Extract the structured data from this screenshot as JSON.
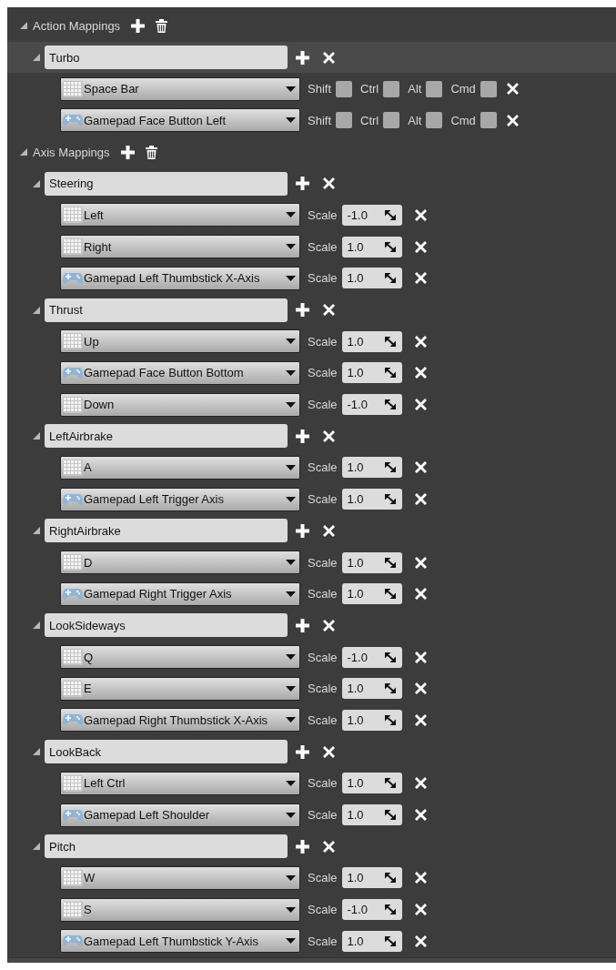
{
  "action_mappings": {
    "label": "Action Mappings",
    "mappings": [
      {
        "name": "Turbo",
        "hovered": true,
        "keys": [
          {
            "kind": "keyboard",
            "key": "Space Bar",
            "modifiers": [
              {
                "label": "Shift",
                "checked": false
              },
              {
                "label": "Ctrl",
                "checked": false
              },
              {
                "label": "Alt",
                "checked": false
              },
              {
                "label": "Cmd",
                "checked": false
              }
            ]
          },
          {
            "kind": "gamepad",
            "key": "Gamepad Face Button Left",
            "modifiers": [
              {
                "label": "Shift",
                "checked": false
              },
              {
                "label": "Ctrl",
                "checked": false
              },
              {
                "label": "Alt",
                "checked": false
              },
              {
                "label": "Cmd",
                "checked": false
              }
            ]
          }
        ]
      }
    ]
  },
  "axis_mappings": {
    "label": "Axis Mappings",
    "mappings": [
      {
        "name": "Steering",
        "hovered": false,
        "keys": [
          {
            "kind": "keyboard",
            "key": "Left",
            "scale_label": "Scale",
            "scale": "-1.0"
          },
          {
            "kind": "keyboard",
            "key": "Right",
            "scale_label": "Scale",
            "scale": "1.0"
          },
          {
            "kind": "gamepad",
            "key": "Gamepad Left Thumbstick X-Axis",
            "scale_label": "Scale",
            "scale": "1.0"
          }
        ]
      },
      {
        "name": "Thrust",
        "hovered": false,
        "keys": [
          {
            "kind": "keyboard",
            "key": "Up",
            "scale_label": "Scale",
            "scale": "1.0"
          },
          {
            "kind": "gamepad",
            "key": "Gamepad Face Button Bottom",
            "scale_label": "Scale",
            "scale": "1.0"
          },
          {
            "kind": "keyboard",
            "key": "Down",
            "scale_label": "Scale",
            "scale": "-1.0"
          }
        ]
      },
      {
        "name": "LeftAirbrake",
        "hovered": false,
        "keys": [
          {
            "kind": "keyboard",
            "key": "A",
            "scale_label": "Scale",
            "scale": "1.0"
          },
          {
            "kind": "gamepad",
            "key": "Gamepad Left Trigger Axis",
            "scale_label": "Scale",
            "scale": "1.0"
          }
        ]
      },
      {
        "name": "RightAirbrake",
        "hovered": false,
        "keys": [
          {
            "kind": "keyboard",
            "key": "D",
            "scale_label": "Scale",
            "scale": "1.0"
          },
          {
            "kind": "gamepad",
            "key": "Gamepad Right Trigger Axis",
            "scale_label": "Scale",
            "scale": "1.0"
          }
        ]
      },
      {
        "name": "LookSideways",
        "hovered": false,
        "keys": [
          {
            "kind": "keyboard",
            "key": "Q",
            "scale_label": "Scale",
            "scale": "-1.0"
          },
          {
            "kind": "keyboard",
            "key": "E",
            "scale_label": "Scale",
            "scale": "1.0"
          },
          {
            "kind": "gamepad",
            "key": "Gamepad Right Thumbstick X-Axis",
            "scale_label": "Scale",
            "scale": "1.0"
          }
        ]
      },
      {
        "name": "LookBack",
        "hovered": false,
        "keys": [
          {
            "kind": "keyboard",
            "key": "Left Ctrl",
            "scale_label": "Scale",
            "scale": "1.0"
          },
          {
            "kind": "gamepad",
            "key": "Gamepad Left Shoulder",
            "scale_label": "Scale",
            "scale": "1.0"
          }
        ]
      },
      {
        "name": "Pitch",
        "hovered": false,
        "keys": [
          {
            "kind": "keyboard",
            "key": "W",
            "scale_label": "Scale",
            "scale": "1.0"
          },
          {
            "kind": "keyboard",
            "key": "S",
            "scale_label": "Scale",
            "scale": "-1.0"
          },
          {
            "kind": "gamepad",
            "key": "Gamepad Left Thumbstick Y-Axis",
            "scale_label": "Scale",
            "scale": "1.0"
          }
        ]
      }
    ]
  }
}
